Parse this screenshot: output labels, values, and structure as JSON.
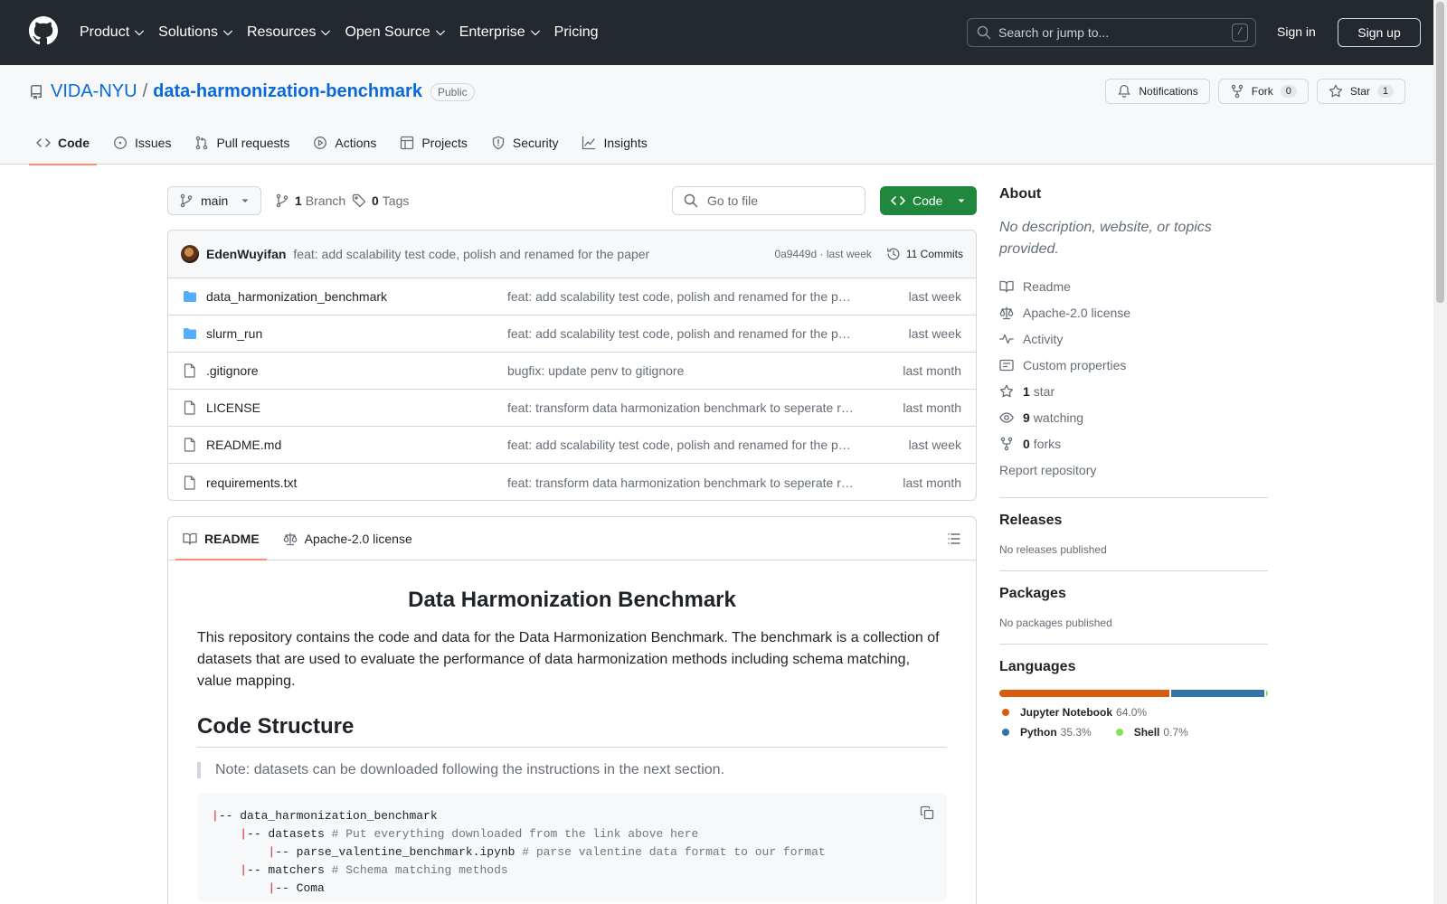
{
  "header": {
    "nav": [
      {
        "label": "Product",
        "dropdown": true
      },
      {
        "label": "Solutions",
        "dropdown": true
      },
      {
        "label": "Resources",
        "dropdown": true
      },
      {
        "label": "Open Source",
        "dropdown": true
      },
      {
        "label": "Enterprise",
        "dropdown": true
      },
      {
        "label": "Pricing",
        "dropdown": false
      }
    ],
    "search_placeholder": "Search or jump to...",
    "search_key": "/",
    "sign_in": "Sign in",
    "sign_up": "Sign up"
  },
  "repo": {
    "owner": "VIDA-NYU",
    "separator": "/",
    "name": "data-harmonization-benchmark",
    "visibility": "Public",
    "actions": {
      "notifications": "Notifications",
      "fork_label": "Fork",
      "fork_count": "0",
      "star_label": "Star",
      "star_count": "1"
    },
    "tabs": [
      {
        "label": "Code",
        "icon": "code-icon",
        "active": true
      },
      {
        "label": "Issues",
        "icon": "issue-icon",
        "active": false
      },
      {
        "label": "Pull requests",
        "icon": "pull-request-icon",
        "active": false
      },
      {
        "label": "Actions",
        "icon": "play-icon",
        "active": false
      },
      {
        "label": "Projects",
        "icon": "table-icon",
        "active": false
      },
      {
        "label": "Security",
        "icon": "shield-icon",
        "active": false
      },
      {
        "label": "Insights",
        "icon": "graph-icon",
        "active": false
      }
    ]
  },
  "toolbar": {
    "branch": "main",
    "branch_count": "1",
    "branch_label": "Branch",
    "tag_count": "0",
    "tag_label": "Tags",
    "goto_file": "Go to file",
    "code_button": "Code"
  },
  "commit": {
    "author": "EdenWuyifan",
    "message": "feat: add scalability test code, polish and renamed for the paper",
    "sha": "0a9449d",
    "dot": "·",
    "when": "last week",
    "commits_label": "11 Commits"
  },
  "files": [
    {
      "name": "data_harmonization_benchmark",
      "type": "dir",
      "message": "feat: add scalability test code, polish and renamed for the p…",
      "date": "last week"
    },
    {
      "name": "slurm_run",
      "type": "dir",
      "message": "feat: add scalability test code, polish and renamed for the p…",
      "date": "last week"
    },
    {
      "name": ".gitignore",
      "type": "file",
      "message": "bugfix: update penv to gitignore",
      "date": "last month"
    },
    {
      "name": "LICENSE",
      "type": "file",
      "message": "feat: transform data harmonization benchmark to seperate r…",
      "date": "last month"
    },
    {
      "name": "README.md",
      "type": "file",
      "message": "feat: add scalability test code, polish and renamed for the p…",
      "date": "last week"
    },
    {
      "name": "requirements.txt",
      "type": "file",
      "message": "feat: transform data harmonization benchmark to seperate r…",
      "date": "last month"
    }
  ],
  "readme": {
    "tabs": [
      {
        "label": "README",
        "active": true
      },
      {
        "label": "Apache-2.0 license",
        "active": false
      }
    ],
    "title": "Data Harmonization Benchmark",
    "intro": "This repository contains the code and data for the Data Harmonization Benchmark. The benchmark is a collection of datasets that are used to evaluate the performance of data harmonization methods including schema matching, value mapping.",
    "section": "Code Structure",
    "note": "Note: datasets can be downloaded following the instructions in the next section.",
    "code_lines": [
      {
        "indent": "",
        "text": "-- data_harmonization_benchmark",
        "comment": ""
      },
      {
        "indent": "    ",
        "text": "-- datasets ",
        "comment": "# Put everything downloaded from the link above here"
      },
      {
        "indent": "        ",
        "text": "-- parse_valentine_benchmark.ipynb ",
        "comment": "# parse valentine data format to our format"
      },
      {
        "indent": "    ",
        "text": "-- matchers ",
        "comment": "# Schema matching methods"
      },
      {
        "indent": "        ",
        "text": "-- Coma",
        "comment": ""
      }
    ]
  },
  "about": {
    "title": "About",
    "description": "No description, website, or topics provided.",
    "links": [
      {
        "icon": "book-icon",
        "count": "",
        "label": "Readme"
      },
      {
        "icon": "law-icon",
        "count": "",
        "label": "Apache-2.0 license"
      },
      {
        "icon": "pulse-icon",
        "count": "",
        "label": "Activity"
      },
      {
        "icon": "note-icon",
        "count": "",
        "label": "Custom properties"
      },
      {
        "icon": "star-icon",
        "count": "1",
        "label": "star"
      },
      {
        "icon": "eye-icon",
        "count": "9",
        "label": "watching"
      },
      {
        "icon": "fork-icon",
        "count": "0",
        "label": "forks"
      }
    ],
    "report": "Report repository"
  },
  "releases": {
    "title": "Releases",
    "empty": "No releases published"
  },
  "packages": {
    "title": "Packages",
    "empty": "No packages published"
  },
  "languages": {
    "title": "Languages",
    "items": [
      {
        "name": "Jupyter Notebook",
        "percent": "64.0%",
        "value": 64.0,
        "color": "#DA5B0B"
      },
      {
        "name": "Python",
        "percent": "35.3%",
        "value": 35.3,
        "color": "#3572A5"
      },
      {
        "name": "Shell",
        "percent": "0.7%",
        "value": 0.7,
        "color": "#89e051"
      }
    ]
  }
}
